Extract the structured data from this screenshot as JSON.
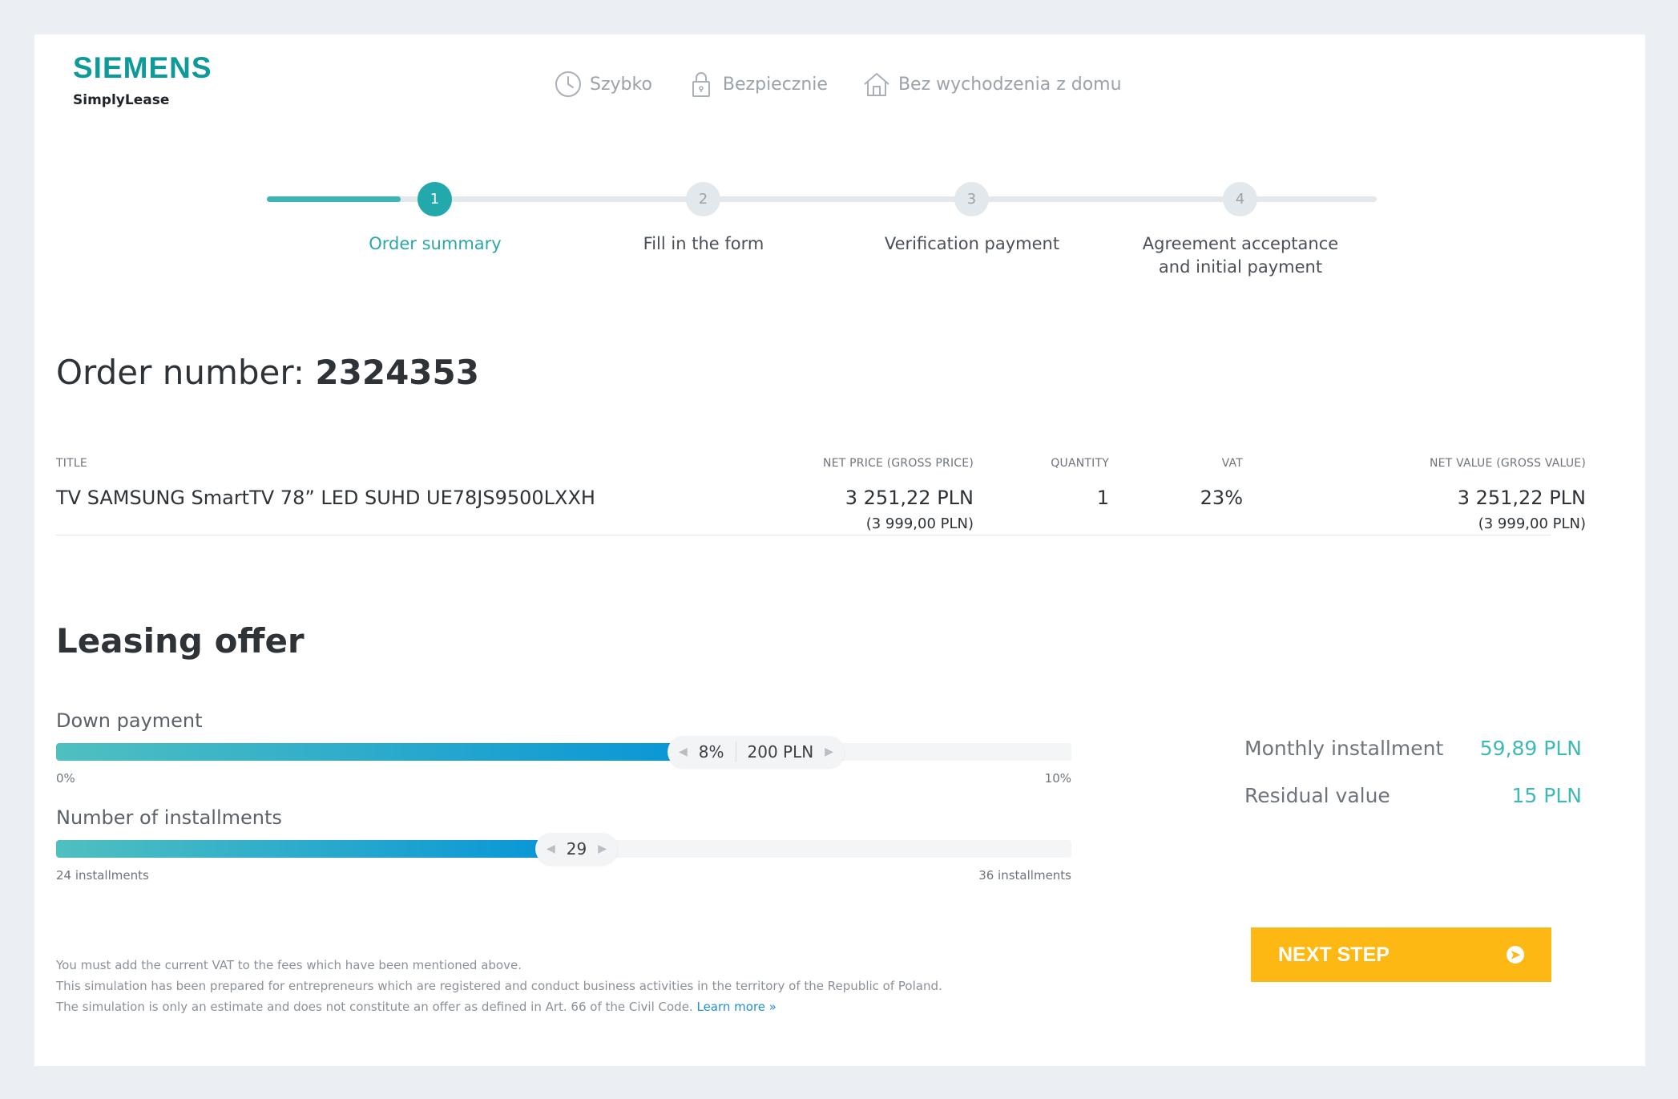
{
  "brand": {
    "name": "SIEMENS",
    "product": "SimplyLease"
  },
  "features": [
    {
      "icon": "clock-icon",
      "label": "Szybko"
    },
    {
      "icon": "lock-icon",
      "label": "Bezpiecznie"
    },
    {
      "icon": "house-icon",
      "label": "Bez wychodzenia z domu"
    }
  ],
  "stepper": {
    "active_step": 1,
    "steps": [
      {
        "number": "1",
        "label": "Order summary"
      },
      {
        "number": "2",
        "label": "Fill in the form"
      },
      {
        "number": "3",
        "label": "Verification payment"
      },
      {
        "number": "4",
        "label_line1": "Agreement acceptance",
        "label_line2": "and initial payment"
      }
    ]
  },
  "order": {
    "label": "Order number:",
    "number": "2324353",
    "columns": {
      "title": "TITLE",
      "net_price": "NET PRICE (GROSS PRICE)",
      "quantity": "QUANTITY",
      "vat": "VAT",
      "net_value": "NET VALUE (GROSS VALUE)"
    },
    "item": {
      "title": "TV SAMSUNG SmartTV 78” LED SUHD UE78JS9500LXXH",
      "net_price": "3 251,22 PLN",
      "gross_price": "(3 999,00 PLN)",
      "quantity": "1",
      "vat": "23%",
      "net_value": "3 251,22 PLN",
      "gross_value": "(3 999,00 PLN)"
    }
  },
  "leasing": {
    "title": "Leasing offer",
    "down_payment": {
      "label": "Down payment",
      "percent": "8%",
      "amount": "200 PLN",
      "min_label": "0%",
      "max_label": "10%",
      "fill_fraction": 0.61
    },
    "installments": {
      "label": "Number of installments",
      "value": "29",
      "min_label": "24 installments",
      "max_label": "36 installments",
      "fill_fraction": 0.48
    },
    "summary": {
      "monthly_label": "Monthly installment",
      "monthly_value": "59,89 PLN",
      "residual_label": "Residual value",
      "residual_value": "15 PLN"
    }
  },
  "notes": {
    "line1": "You must add the current VAT to the fees which have been mentioned above.",
    "line2": "This simulation has been prepared for entrepreneurs which are registered and conduct business activities in the territory of the Republic of Poland.",
    "line3": "The simulation is only an estimate and does not constitute an offer as defined in Art. 66 of the Civil Code.",
    "learn_more": "Learn more »"
  },
  "next_button": {
    "label": "NEXT STEP",
    "icon": "arrow-right-circle-icon"
  },
  "colors": {
    "accent": "#23a9ab",
    "button": "#fdb813",
    "link": "#1f8fd6"
  }
}
